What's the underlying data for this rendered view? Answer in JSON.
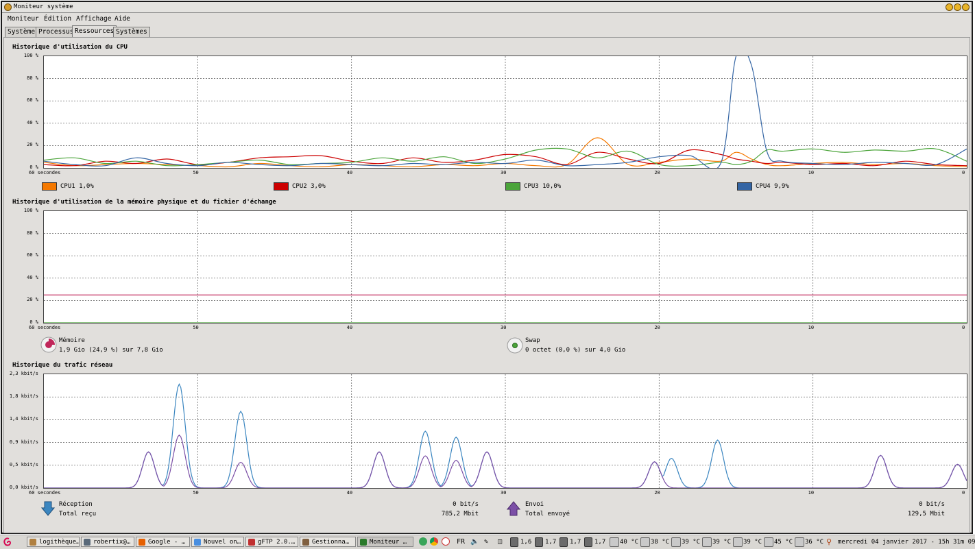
{
  "window": {
    "title": "Moniteur système"
  },
  "menu": [
    {
      "label": "Moniteur"
    },
    {
      "label": "Édition"
    },
    {
      "label": "Affichage"
    },
    {
      "label": "Aide"
    }
  ],
  "tabs": [
    {
      "label": "Système"
    },
    {
      "label": "Processus"
    },
    {
      "label": "Ressources"
    },
    {
      "label": "Systèmes de fichiers"
    }
  ],
  "active_tab": "Ressources",
  "cpu": {
    "title": "Historique d'utilisation du CPU",
    "legend": [
      {
        "label": "CPU1 1,0%",
        "color": "#f57900"
      },
      {
        "label": "CPU2 3,0%",
        "color": "#cc0000"
      },
      {
        "label": "CPU3 10,0%",
        "color": "#4ba43a"
      },
      {
        "label": "CPU4 9,9%",
        "color": "#3465a4"
      }
    ]
  },
  "memory": {
    "title": "Historique d'utilisation de la mémoire physique et du fichier d'échange",
    "mem_label": "Mémoire",
    "mem_value": "1,9 Gio (24,9 %) sur 7,8 Gio",
    "mem_color": "#c0265a",
    "swap_label": "Swap",
    "swap_value": "0 octet (0,0 %) sur 4,0 Gio",
    "swap_color": "#4ba43a"
  },
  "network": {
    "title": "Historique du trafic réseau",
    "recv_label": "Réception",
    "recv_rate": "0 bit/s",
    "recv_total_label": "Total reçu",
    "recv_total": "785,2 Mbit",
    "send_label": "Envoi",
    "send_rate": "0 bit/s",
    "send_total_label": "Total envoyé",
    "send_total": "129,5 Mbit",
    "recv_color": "#3b86c0",
    "send_color": "#7b4fa6"
  },
  "taskbar": {
    "tasks": [
      {
        "label": "logithèque…",
        "icon": "folder-icon",
        "color": "#b08040"
      },
      {
        "label": "robertix@…",
        "icon": "terminal-icon",
        "color": "#5a6a7a"
      },
      {
        "label": "Google - …",
        "icon": "firefox-icon",
        "color": "#e66000"
      },
      {
        "label": "Nouvel on…",
        "icon": "chrome-icon",
        "color": "#4a8fe0"
      },
      {
        "label": "gFTP 2.0.…",
        "icon": "gftp-icon",
        "color": "#c03030"
      },
      {
        "label": "Gestionna…",
        "icon": "package-icon",
        "color": "#806040"
      },
      {
        "label": "Moniteur …",
        "icon": "monitor-icon",
        "color": "#2a7a2a"
      }
    ],
    "keyboard": "FR",
    "cpu_freqs": [
      "1,6",
      "1,7",
      "1,7",
      "1,7"
    ],
    "temps": [
      "40 °C",
      "38 °C",
      "39 °C",
      "39 °C",
      "39 °C",
      "45 °C",
      "36 °C"
    ],
    "clock": "mercredi 04 janvier 2017 - 15h 31m 09s"
  },
  "chart_data": [
    {
      "type": "line",
      "title": "Historique d'utilisation du CPU",
      "x_ticks": [
        "60 secondes",
        "50",
        "40",
        "30",
        "20",
        "10",
        "0"
      ],
      "y_ticks": [
        "100 %",
        "80 %",
        "60 %",
        "40 %",
        "20 %",
        "0 %"
      ],
      "xlim": [
        60,
        0
      ],
      "ylim": [
        0,
        100
      ],
      "x": [
        60,
        58,
        56,
        54,
        52,
        50,
        48,
        46,
        44,
        42,
        40,
        38,
        36,
        34,
        32,
        30,
        28,
        26,
        24,
        22,
        20,
        18,
        16,
        15,
        14,
        13,
        12,
        10,
        8,
        6,
        4,
        2,
        0
      ],
      "series": [
        {
          "name": "CPU1 1,0%",
          "values": [
            5,
            2,
            3,
            4,
            3,
            2,
            1,
            4,
            2,
            1,
            3,
            2,
            1,
            3,
            2,
            4,
            2,
            3,
            27,
            3,
            5,
            8,
            6,
            14,
            8,
            3,
            2,
            4,
            5,
            3,
            4,
            2,
            1
          ]
        },
        {
          "name": "CPU2 3,0%",
          "values": [
            3,
            2,
            6,
            4,
            8,
            3,
            5,
            9,
            10,
            11,
            6,
            4,
            9,
            5,
            7,
            12,
            10,
            3,
            14,
            8,
            4,
            16,
            12,
            8,
            6,
            4,
            5,
            3,
            4,
            2,
            6,
            3,
            2
          ]
        },
        {
          "name": "CPU3 10,0%",
          "values": [
            7,
            9,
            4,
            6,
            2,
            3,
            5,
            7,
            3,
            4,
            5,
            9,
            6,
            10,
            4,
            8,
            16,
            17,
            9,
            15,
            3,
            2,
            5,
            3,
            6,
            16,
            15,
            17,
            14,
            16,
            15,
            17,
            6
          ]
        },
        {
          "name": "CPU4 9,9%",
          "values": [
            6,
            3,
            2,
            9,
            4,
            2,
            5,
            3,
            2,
            4,
            3,
            2,
            4,
            3,
            5,
            4,
            7,
            2,
            3,
            5,
            10,
            11,
            4,
            100,
            92,
            15,
            6,
            4,
            3,
            5,
            4,
            3,
            17
          ]
        }
      ]
    },
    {
      "type": "line",
      "title": "Historique d'utilisation de la mémoire physique et du fichier d'échange",
      "x_ticks": [
        "60 secondes",
        "50",
        "40",
        "30",
        "20",
        "10",
        "0"
      ],
      "y_ticks": [
        "100 %",
        "80 %",
        "60 %",
        "40 %",
        "20 %",
        "0 %"
      ],
      "xlim": [
        60,
        0
      ],
      "ylim": [
        0,
        100
      ],
      "x": [
        60,
        0
      ],
      "series": [
        {
          "name": "Mémoire",
          "values": [
            24.9,
            24.9
          ]
        },
        {
          "name": "Swap",
          "values": [
            0,
            0
          ]
        }
      ]
    },
    {
      "type": "line",
      "title": "Historique du trafic réseau",
      "x_ticks": [
        "60 secondes",
        "50",
        "40",
        "30",
        "20",
        "10",
        "0"
      ],
      "y_ticks": [
        "2,3 kbit/s",
        "1,8 kbit/s",
        "1,4 kbit/s",
        "0,9 kbit/s",
        "0,5 kbit/s",
        "0,0 kbit/s"
      ],
      "xlim": [
        60,
        0
      ],
      "ylim": [
        0,
        2.3
      ],
      "series": [
        {
          "name": "Réception",
          "peaks": [
            [
              53.2,
              0.73
            ],
            [
              51.2,
              2.1
            ],
            [
              47.2,
              1.55
            ],
            [
              38.2,
              0.73
            ],
            [
              35.2,
              1.15
            ],
            [
              33.2,
              1.03
            ],
            [
              31.2,
              0.73
            ],
            [
              20.3,
              0.53
            ],
            [
              19.2,
              0.6
            ],
            [
              16.2,
              0.97
            ],
            [
              5.6,
              0.66
            ],
            [
              0.6,
              0.48
            ]
          ]
        },
        {
          "name": "Envoi",
          "peaks": [
            [
              53.2,
              0.73
            ],
            [
              51.2,
              1.07
            ],
            [
              47.2,
              0.52
            ],
            [
              38.2,
              0.73
            ],
            [
              35.2,
              0.65
            ],
            [
              33.2,
              0.56
            ],
            [
              31.2,
              0.73
            ],
            [
              20.3,
              0.53
            ],
            [
              5.6,
              0.66
            ],
            [
              0.6,
              0.48
            ]
          ]
        }
      ]
    }
  ]
}
